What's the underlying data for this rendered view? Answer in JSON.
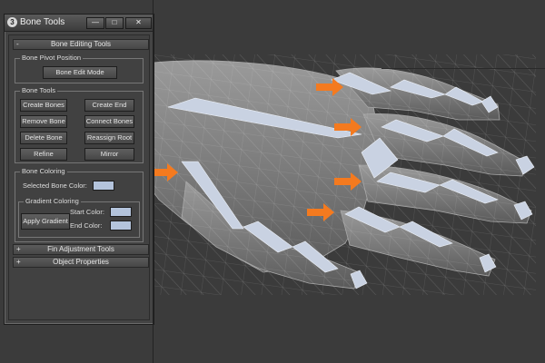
{
  "window": {
    "title": "Bone Tools",
    "controls": {
      "minimize": "—",
      "maximize": "□",
      "close": "✕"
    }
  },
  "rollouts": {
    "bone_editing": {
      "sign": "-",
      "label": "Bone Editing Tools"
    },
    "fin_adjustment": {
      "sign": "+",
      "label": "Fin Adjustment Tools"
    },
    "object_properties": {
      "sign": "+",
      "label": "Object Properties"
    }
  },
  "bone_pivot": {
    "group_label": "Bone Pivot Position",
    "edit_mode_button": "Bone Edit Mode"
  },
  "bone_tools": {
    "group_label": "Bone Tools",
    "buttons": {
      "create_bones": "Create Bones",
      "create_end": "Create End",
      "remove_bone": "Remove Bone",
      "connect_bones": "Connect Bones",
      "delete_bone": "Delete Bone",
      "reassign_root": "Reassign Root",
      "refine": "Refine",
      "mirror": "Mirror"
    }
  },
  "bone_coloring": {
    "group_label": "Bone Coloring",
    "selected_color_label": "Selected Bone Color:",
    "gradient_group_label": "Gradient Coloring",
    "apply_gradient_button": "Apply Gradient",
    "start_color_label": "Start Color:",
    "end_color_label": "End Color:",
    "colors": {
      "selected": "#b4c4dc",
      "start": "#b4c4dc",
      "end": "#b4c4dc"
    }
  },
  "viewport": {
    "background": "#3a3a3a",
    "mesh_color": "#8a8a8a",
    "bone_color": "#c9d2e2",
    "arrow_color": "#f47a1f"
  }
}
